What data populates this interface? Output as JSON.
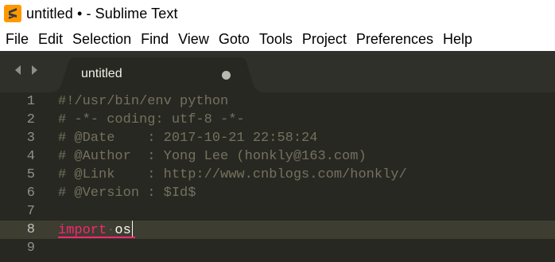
{
  "window": {
    "title": "untitled • - Sublime Text"
  },
  "menu": [
    "File",
    "Edit",
    "Selection",
    "Find",
    "View",
    "Goto",
    "Tools",
    "Project",
    "Preferences",
    "Help"
  ],
  "tab": {
    "label": "untitled"
  },
  "gutter": [
    "1",
    "2",
    "3",
    "4",
    "5",
    "6",
    "7",
    "8",
    "9"
  ],
  "code": {
    "line1": "#!/usr/bin/env python",
    "line2": "# -*- coding: utf-8 -*-",
    "line3": "# @Date    : 2017-10-21 22:58:24",
    "line4": "# @Author  : Yong Lee (honkly@163.com)",
    "line5": "# @Link    : http://www.cnblogs.com/honkly/",
    "line6": "# @Version : $Id$",
    "line7": "",
    "line8_keyword": "import",
    "line8_ws": "·",
    "line8_name": "os",
    "line9": ""
  },
  "colors": {
    "background": "#272822",
    "comment": "#75715e",
    "keyword": "#f92672",
    "text": "#f8f8f2",
    "line_highlight": "#3e3d32",
    "app_icon": "#ff9800"
  },
  "icons": {
    "app": "sublime-text-icon",
    "back": "left-arrow-icon",
    "forward": "right-arrow-icon",
    "dirty": "unsaved-dot-icon"
  }
}
